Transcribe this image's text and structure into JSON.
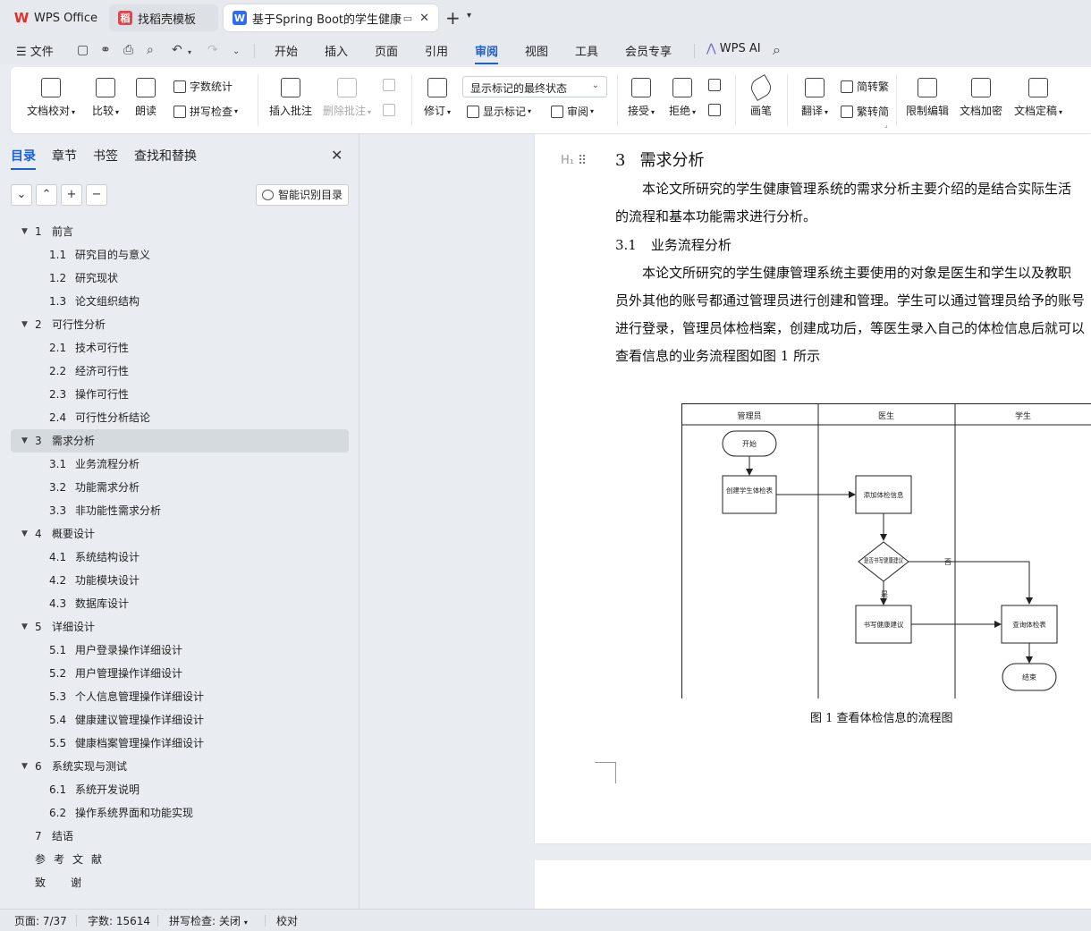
{
  "tabs": {
    "wps_office": "WPS Office",
    "template": "找稻壳模板",
    "document": "基于Spring Boot的学生健康管理系统"
  },
  "menu": {
    "file": "文件",
    "items": [
      "开始",
      "插入",
      "页面",
      "引用",
      "审阅",
      "视图",
      "工具",
      "会员专享"
    ],
    "active": "审阅",
    "wps_ai": "WPS AI"
  },
  "ribbon": {
    "doc_proofread": "文档校对",
    "compare": "比较",
    "read_aloud": "朗读",
    "word_count": "字数统计",
    "spell_check": "拼写检查",
    "insert_comment": "插入批注",
    "delete_comment": "删除批注",
    "track_changes": "修订",
    "markup_state": "显示标记的最终状态",
    "show_markup": "显示标记",
    "review": "审阅",
    "accept": "接受",
    "reject": "拒绝",
    "pen": "画笔",
    "translate": "翻译",
    "to_traditional": "简转繁",
    "to_simplified": "繁转简",
    "restrict_edit": "限制编辑",
    "encrypt": "文档加密",
    "finalize": "文档定稿"
  },
  "sidebar": {
    "tabs": [
      "目录",
      "章节",
      "书签",
      "查找和替换"
    ],
    "active_tab": "目录",
    "smart_toc": "智能识别目录",
    "toc": [
      {
        "num": "1",
        "title": "前言",
        "level": 1,
        "expanded": true
      },
      {
        "num": "1.1",
        "title": "研究目的与意义",
        "level": 2
      },
      {
        "num": "1.2",
        "title": "研究现状",
        "level": 2
      },
      {
        "num": "1.3",
        "title": "论文组织结构",
        "level": 2
      },
      {
        "num": "2",
        "title": "可行性分析",
        "level": 1,
        "expanded": true
      },
      {
        "num": "2.1",
        "title": "技术可行性",
        "level": 2
      },
      {
        "num": "2.2",
        "title": "经济可行性",
        "level": 2
      },
      {
        "num": "2.3",
        "title": "操作可行性",
        "level": 2
      },
      {
        "num": "2.4",
        "title": "可行性分析结论",
        "level": 2
      },
      {
        "num": "3",
        "title": "需求分析",
        "level": 1,
        "expanded": true,
        "selected": true
      },
      {
        "num": "3.1",
        "title": "业务流程分析",
        "level": 2
      },
      {
        "num": "3.2",
        "title": "功能需求分析",
        "level": 2
      },
      {
        "num": "3.3",
        "title": "非功能性需求分析",
        "level": 2
      },
      {
        "num": "4",
        "title": "概要设计",
        "level": 1,
        "expanded": true
      },
      {
        "num": "4.1",
        "title": "系统结构设计",
        "level": 2
      },
      {
        "num": "4.2",
        "title": "功能模块设计",
        "level": 2
      },
      {
        "num": "4.3",
        "title": "数据库设计",
        "level": 2
      },
      {
        "num": "5",
        "title": "详细设计",
        "level": 1,
        "expanded": true
      },
      {
        "num": "5.1",
        "title": "用户登录操作详细设计",
        "level": 2
      },
      {
        "num": "5.2",
        "title": "用户管理操作详细设计",
        "level": 2
      },
      {
        "num": "5.3",
        "title": "个人信息管理操作详细设计",
        "level": 2
      },
      {
        "num": "5.4",
        "title": "健康建议管理操作详细设计",
        "level": 2
      },
      {
        "num": "5.5",
        "title": "健康档案管理操作详细设计",
        "level": 2
      },
      {
        "num": "6",
        "title": "系统实现与测试",
        "level": 1,
        "expanded": true
      },
      {
        "num": "6.1",
        "title": "系统开发说明",
        "level": 2
      },
      {
        "num": "6.2",
        "title": "操作系统界面和功能实现",
        "level": 2
      },
      {
        "num": "7",
        "title": "结语",
        "level": 1
      },
      {
        "num": "",
        "title": "参考文献",
        "level": 1,
        "style": "spaced"
      },
      {
        "num": "",
        "title": "致谢",
        "level": 1,
        "style": "spaced2"
      }
    ]
  },
  "document": {
    "heading_num": "3",
    "heading": "需求分析",
    "para1_line1": "本论文所研究的学生健康管理系统的需求分析主要介绍的是结合实际生活",
    "para1_line2": "的流程和基本功能需求进行分析。",
    "sub_num": "3.1",
    "sub_heading": "业务流程分析",
    "para2_line1": "本论文所研究的学生健康管理系统主要使用的对象是医生和学生以及教职",
    "para2_line2": "员外其他的账号都通过管理员进行创建和管理。学生可以通过管理员给予的账号",
    "para2_line3": "进行登录，管理员体检档案，创建成功后，等医生录入自己的体检信息后就可以",
    "para2_line4": "查看信息的业务流程图如图 1 所示",
    "figure_caption": "图 1  查看体检信息的流程图"
  },
  "flowchart": {
    "lanes": [
      "管理员",
      "医生",
      "学生"
    ],
    "start": "开始",
    "create_exam_form": "创建学生体检表",
    "add_exam_info": "添加体检信息",
    "decision": "是否书写健康建议",
    "no_label": "否",
    "yes_label": "是",
    "write_advice": "书写健康建议",
    "query_exam": "查询体检表",
    "end": "结束"
  },
  "status": {
    "page": "页面: 7/37",
    "word_count": "字数: 15614",
    "spell_check": "拼写检查: 关闭",
    "proofread": "校对"
  },
  "colors": {
    "accent": "#1a5fd8",
    "wps_red": "#e0302a",
    "doc_blue": "#2f6bf0"
  }
}
